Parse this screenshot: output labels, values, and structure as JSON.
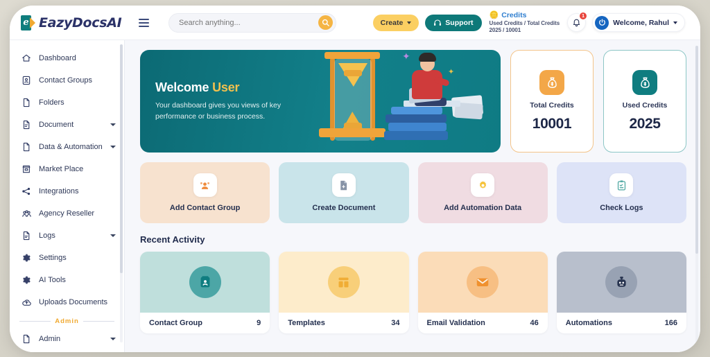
{
  "brand": {
    "name": "EazyDocsAI",
    "mark_letter": "e"
  },
  "header": {
    "menu_icon": "hamburger-icon",
    "search": {
      "placeholder": "Search anything...",
      "value": "",
      "icon": "search-icon"
    },
    "create_label": "Create",
    "support_label": "Support",
    "support_icon": "headset-icon",
    "credits": {
      "title": "Credits",
      "subtitle": "Used Credits / Total Credits",
      "values": "2025 / 10001",
      "icon": "coins-icon"
    },
    "notification": {
      "icon": "bell-icon",
      "badge": "1"
    },
    "user": {
      "label": "Welcome, Rahul",
      "avatar_icon": "power-user-icon"
    }
  },
  "sidebar": {
    "items": [
      {
        "label": "Dashboard",
        "icon": "home-icon",
        "has_arrow": false
      },
      {
        "label": "Contact Groups",
        "icon": "contact-card-icon",
        "has_arrow": false
      },
      {
        "label": "Folders",
        "icon": "file-icon",
        "has_arrow": false
      },
      {
        "label": "Document",
        "icon": "document-icon",
        "has_arrow": true
      },
      {
        "label": "Data & Automation",
        "icon": "data-icon",
        "has_arrow": true
      },
      {
        "label": "Market Place",
        "icon": "store-icon",
        "has_arrow": false
      },
      {
        "label": "Integrations",
        "icon": "integrations-icon",
        "has_arrow": false
      },
      {
        "label": "Agency Reseller",
        "icon": "agency-icon",
        "has_arrow": false
      },
      {
        "label": "Logs",
        "icon": "log-file-icon",
        "has_arrow": true
      },
      {
        "label": "Settings",
        "icon": "gear-icon",
        "has_arrow": false
      },
      {
        "label": "AI Tools",
        "icon": "gear-icon",
        "has_arrow": false
      },
      {
        "label": "Uploads Documents",
        "icon": "upload-cloud-icon",
        "has_arrow": false
      }
    ],
    "divider_label": "Admin",
    "admin_items": [
      {
        "label": "Admin",
        "icon": "admin-file-icon",
        "has_arrow": true
      }
    ]
  },
  "main": {
    "banner": {
      "title_prefix": "Welcome ",
      "title_accent": "User",
      "subtitle": "Your dashboard gives you views of key performance or business process.",
      "illustration": "hourglass-person-books-illustration"
    },
    "credit_cards": [
      {
        "label": "Total Credits",
        "value": "10001",
        "icon": "money-bag-icon",
        "accent": "#f3a748"
      },
      {
        "label": "Used Credits",
        "value": "2025",
        "icon": "money-bag-icon",
        "accent": "#0f7d80"
      }
    ],
    "action_cards": [
      {
        "label": "Add Contact Group",
        "icon": "contacts-add-icon",
        "bg": "#f7e2cf",
        "icon_color": "#ef8b3c"
      },
      {
        "label": "Create Document",
        "icon": "document-add-icon",
        "bg": "#c9e4ea",
        "icon_color": "#8793a6"
      },
      {
        "label": "Add Automation Data",
        "icon": "gear-sun-icon",
        "bg": "#f0dce2",
        "icon_color": "#f5c033"
      },
      {
        "label": "Check Logs",
        "icon": "clipboard-check-icon",
        "bg": "#dde3f7",
        "icon_color": "#4fa8a2"
      }
    ],
    "recent_activity": {
      "title": "Recent Activity",
      "cards": [
        {
          "name": "Contact Group",
          "count": "9",
          "icon": "contact-card-icon",
          "bg": "#bfdfdc",
          "circle": "#4ca6a6",
          "icon_color": "#0f7d80"
        },
        {
          "name": "Templates",
          "count": "34",
          "icon": "template-grid-icon",
          "bg": "#fdeccb",
          "circle": "#f8cf79",
          "icon_color": "#f0ad35"
        },
        {
          "name": "Email Validation",
          "count": "46",
          "icon": "envelope-icon",
          "bg": "#fbdcb8",
          "circle": "#f7bf83",
          "icon_color": "#f0912f"
        },
        {
          "name": "Automations",
          "count": "166",
          "icon": "robot-icon",
          "bg": "#b8bfcc",
          "circle": "#98a2b3",
          "icon_color": "#27334f"
        }
      ]
    }
  }
}
